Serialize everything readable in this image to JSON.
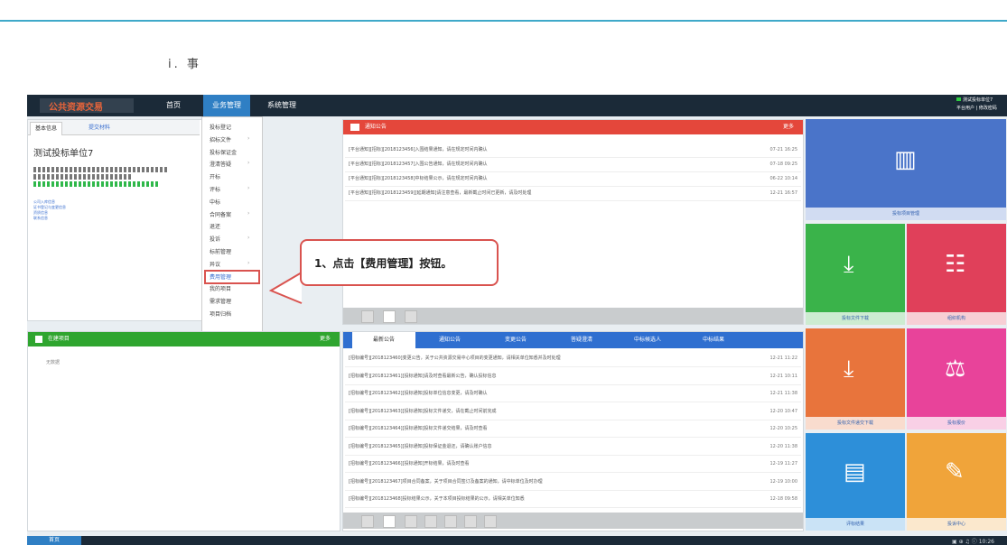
{
  "page": {
    "title": "ⅰ. 事"
  },
  "header": {
    "logo_text": "公共资源交易",
    "nav": [
      "首页",
      "业务管理",
      "系统管理"
    ],
    "user": [
      "测试投标单位7",
      "平台用户 | 修改密码"
    ]
  },
  "left_panel": {
    "tabs": [
      "基本信息",
      "提交材料"
    ],
    "company": "测试投标单位7",
    "links": [
      "公司入库信息",
      "证书登记与变更信息",
      "资质信息",
      "联系信息"
    ]
  },
  "menu": {
    "items": [
      "投标登记",
      "招标文件",
      "投标保证金",
      "澄清答疑",
      "开标",
      "评标",
      "中标",
      "合同备案",
      "退还",
      "投诉",
      "标前管理",
      "异议",
      "费用管理",
      "我的项目",
      "需求管理",
      "项目归档"
    ],
    "highlighted_index": 12
  },
  "notice": {
    "title": "通知公告",
    "more": "更多",
    "rows": [
      {
        "text": "[平台通知][招标][2018123456]入围结果通知，请在规定时间内确认",
        "time": "07-21 16:25"
      },
      {
        "text": "[平台通知][招标][2018123457]入围公告通知，请在规定时间内确认",
        "time": "07-18 09:25"
      },
      {
        "text": "[平台通知][招标][2018123458]中标结果公示，请在规定时间内确认",
        "time": "06-22 10:14"
      },
      {
        "text": "[平台通知][招标][2018123459][延期通知]请注意查看，最新截止时间已更新，请及时处理",
        "time": "12-21 16:57"
      }
    ]
  },
  "callout": {
    "text": "1、点击【费用管理】按钮。"
  },
  "project_panel": {
    "title": "在建项目",
    "more": "更多",
    "empty": "无数据"
  },
  "message_panel": {
    "tabs": [
      "最新公告",
      "通知公告",
      "变更公告",
      "答疑澄清",
      "中标候选人",
      "中标结果"
    ],
    "rows": [
      {
        "text": "[招标编号][2018123460]变更公告，关于公共资源交易中心项目的变更通知，请相关单位知悉并及时处理",
        "time": "12-21 11:22"
      },
      {
        "text": "[招标编号][2018123461][投标通知]请及时查看最新公告，确认投标信息",
        "time": "12-21 10:11"
      },
      {
        "text": "[招标编号][2018123462][投标通知]投标单位信息变更，请及时确认",
        "time": "12-21 11:38"
      },
      {
        "text": "[招标编号][2018123463][投标通知]投标文件递交，请在截止时间前完成",
        "time": "12-20 10:47"
      },
      {
        "text": "[招标编号][2018123464][投标通知]投标文件递交结果，请及时查看",
        "time": "12-20 10:25"
      },
      {
        "text": "[招标编号][2018123465][投标通知]投标保证金退还，请确认账户信息",
        "time": "12-20 11:38"
      },
      {
        "text": "[招标编号][2018123466][投标通知]开标结果，请及时查看",
        "time": "12-19 11:27"
      },
      {
        "text": "[招标编号][2018123467]项目合同备案，关于项目合同签订及备案的通知，请中标单位及时办理",
        "time": "12-19 10:00"
      },
      {
        "text": "[招标编号][2018123468]投标结果公示，关于本项目投标结果的公示，请相关单位知悉",
        "time": "12-18 09:58"
      }
    ]
  },
  "tiles": [
    {
      "label": "投标项目管理",
      "color": "#4a74c9",
      "icon": "piano-icon"
    },
    {
      "label": "投标文件下载",
      "color": "#3ab34a",
      "icon": "download-icon"
    },
    {
      "label": "组织机构",
      "color": "#e0405a",
      "icon": "org-icon"
    },
    {
      "label": "投标文件递交下载",
      "color": "#e8743c",
      "icon": "download-icon"
    },
    {
      "label": "投标报价",
      "color": "#e8439a",
      "icon": "scale-icon"
    },
    {
      "label": "评标结果",
      "color": "#2d8fd9",
      "icon": "document-icon"
    },
    {
      "label": "投诉中心",
      "color": "#f0a43a",
      "icon": "edit-icon"
    }
  ],
  "bottom": {
    "start": "首页",
    "tray": "▣ ⊕ ♫ ⓘ  10:26"
  }
}
